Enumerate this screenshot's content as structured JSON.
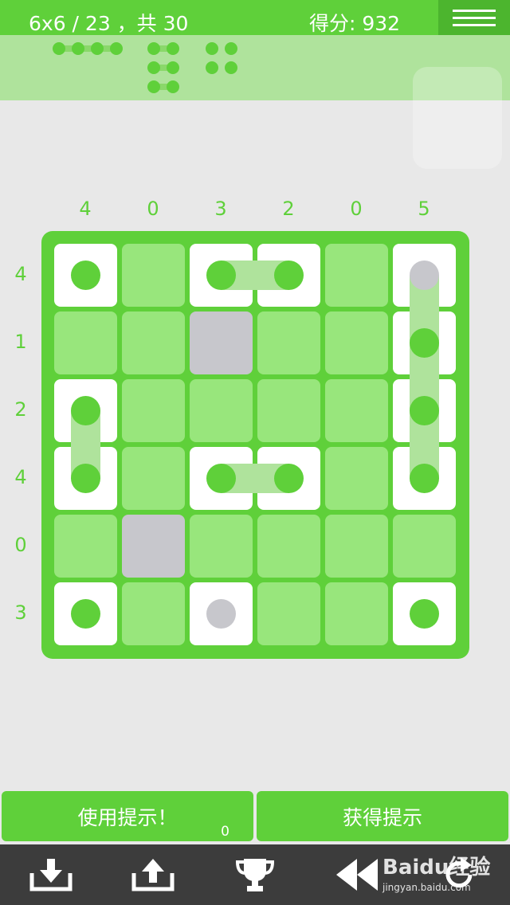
{
  "header": {
    "level": "6x6 / 23 ，共 30",
    "score": "得分: 932"
  },
  "clues": {
    "columns": [
      "4",
      "0",
      "3",
      "2",
      "0",
      "5"
    ],
    "rows": [
      "4",
      "1",
      "2",
      "4",
      "0",
      "3"
    ]
  },
  "buttons": {
    "use_hint": "使用提示！",
    "use_hint_count": "0",
    "get_hint": "获得提示"
  },
  "watermark": {
    "brand": "Baidu经验",
    "url": "jingyan.baidu.com"
  },
  "colors": {
    "accent": "#5fd03a",
    "cell": "#98e67c",
    "light": "#afe39c",
    "gray": "#c7c7cc",
    "footer": "#3c3c3c"
  },
  "icons": [
    "download-icon",
    "upload-icon",
    "trophy-icon",
    "rewind-icon",
    "restart-icon",
    "menu-icon"
  ]
}
